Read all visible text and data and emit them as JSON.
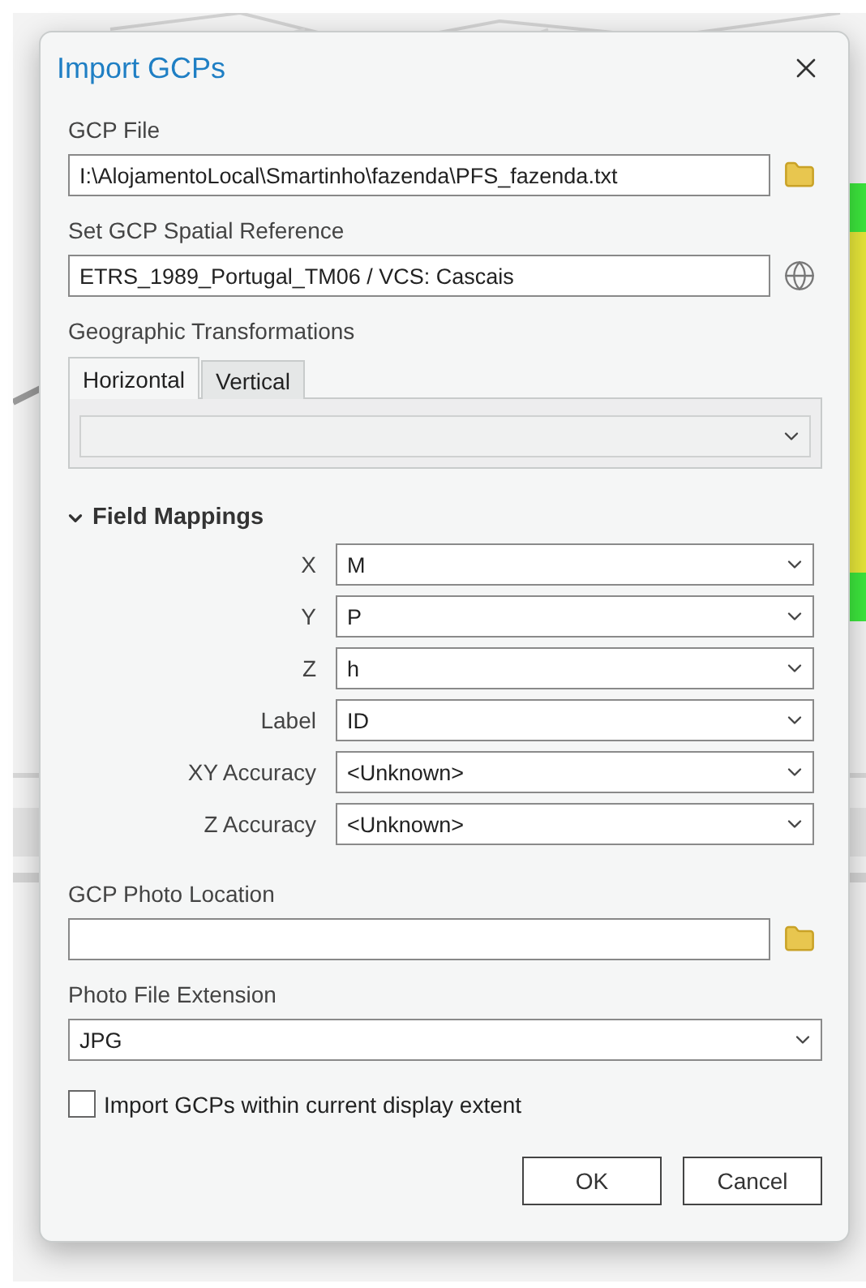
{
  "dialog": {
    "title": "Import GCPs"
  },
  "gcp_file": {
    "label": "GCP File",
    "value": "I:\\AlojamentoLocal\\Smartinho\\fazenda\\PFS_fazenda.txt"
  },
  "spatial_reference": {
    "label": "Set GCP Spatial Reference",
    "value": "ETRS_1989_Portugal_TM06 / VCS: Cascais"
  },
  "geographic_transformations": {
    "label": "Geographic Transformations",
    "tabs": [
      {
        "label": "Horizontal",
        "selected": true
      },
      {
        "label": "Vertical",
        "selected": false
      }
    ]
  },
  "field_mappings": {
    "label": "Field Mappings",
    "expanded": true,
    "rows": [
      {
        "label": "X",
        "value": "M"
      },
      {
        "label": "Y",
        "value": "P"
      },
      {
        "label": "Z",
        "value": "h"
      },
      {
        "label": "Label",
        "value": "ID"
      },
      {
        "label": "XY Accuracy",
        "value": "<Unknown>"
      },
      {
        "label": "Z Accuracy",
        "value": "<Unknown>"
      }
    ]
  },
  "photo_location": {
    "label": "GCP Photo Location"
  },
  "photo_extension": {
    "label": "Photo File Extension",
    "value": "JPG"
  },
  "display_extent": {
    "label": "Import GCPs within current display extent",
    "checked": false
  },
  "buttons": [
    {
      "label": "OK"
    },
    {
      "label": "Cancel"
    }
  ]
}
